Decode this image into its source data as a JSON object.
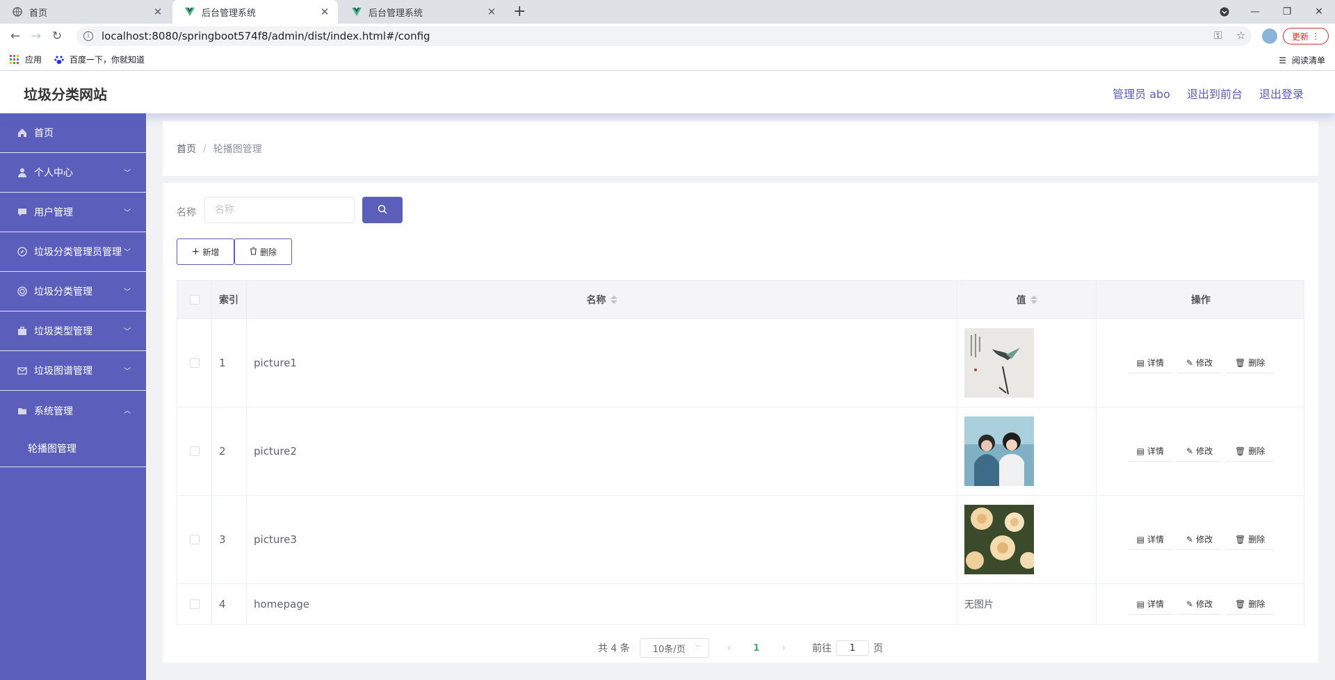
{
  "browser": {
    "tabs": [
      {
        "title": "首页"
      },
      {
        "title": "后台管理系统"
      },
      {
        "title": "后台管理系统"
      }
    ],
    "url": "localhost:8080/springboot574f8/admin/dist/index.html#/config",
    "update_label": "更新",
    "bookmarks": [
      {
        "label": "应用"
      },
      {
        "label": "百度一下，你就知道"
      }
    ],
    "reading_list": "阅读清单"
  },
  "header": {
    "brand": "垃圾分类网站",
    "admin_label": "管理员 abo",
    "front_label": "退出到前台",
    "logout_label": "退出登录"
  },
  "sidebar": {
    "items": [
      {
        "label": "首页",
        "icon": "home-icon"
      },
      {
        "label": "个人中心",
        "icon": "user-icon"
      },
      {
        "label": "用户管理",
        "icon": "chat-icon"
      },
      {
        "label": "垃圾分类管理员管理",
        "icon": "compass-icon"
      },
      {
        "label": "垃圾分类管理",
        "icon": "circle-icon"
      },
      {
        "label": "垃圾类型管理",
        "icon": "briefcase-icon"
      },
      {
        "label": "垃圾图谱管理",
        "icon": "mail-icon"
      },
      {
        "label": "系统管理",
        "icon": "folder-icon"
      }
    ],
    "subitem": "轮播图管理"
  },
  "breadcrumb": {
    "home": "首页",
    "sep": "/",
    "current": "轮播图管理"
  },
  "search": {
    "label": "名称",
    "placeholder": "名称"
  },
  "actions": {
    "add": "新增",
    "delete": "删除"
  },
  "table": {
    "headers": {
      "index": "索引",
      "name": "名称",
      "value": "值",
      "ops": "操作"
    },
    "rows": [
      {
        "index": "1",
        "name": "picture1",
        "value": "image"
      },
      {
        "index": "2",
        "name": "picture2",
        "value": "image"
      },
      {
        "index": "3",
        "name": "picture3",
        "value": "image"
      },
      {
        "index": "4",
        "name": "homepage",
        "value": "无图片"
      }
    ],
    "op_labels": {
      "detail": "详情",
      "edit": "修改",
      "delete": "删除"
    }
  },
  "pager": {
    "total": "共 4 条",
    "size": "10条/页",
    "current": "1",
    "goto": "前往",
    "goto_value": "1",
    "page_unit": "页"
  },
  "colors": {
    "primary": "#5b5fbb",
    "active_page": "#3fb26e"
  }
}
